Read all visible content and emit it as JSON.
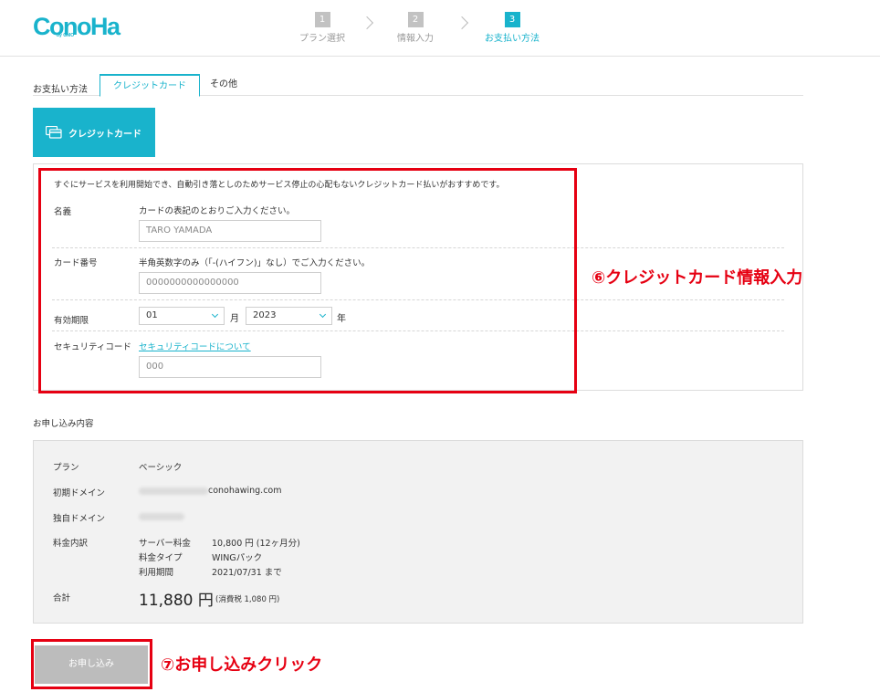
{
  "header": {
    "logo": "ConoHa",
    "logo_sub": "by GMO",
    "steps": [
      {
        "num": "1",
        "label": "プラン選択"
      },
      {
        "num": "2",
        "label": "情報入力"
      },
      {
        "num": "3",
        "label": "お支払い方法"
      }
    ]
  },
  "payment_tabs": {
    "label": "お支払い方法",
    "tabs": [
      "クレジットカード",
      "その他"
    ]
  },
  "card_button_label": "クレジットカード",
  "form": {
    "intro": "すぐにサービスを利用開始でき、自動引き落としのためサービス停止の心配もないクレジットカード払いがおすすめです。",
    "name": {
      "label": "名義",
      "note": "カードの表記のとおりご入力ください。",
      "placeholder": "TARO YAMADA"
    },
    "number": {
      "label": "カード番号",
      "note": "半角英数字のみ（「-(ハイフン)」なし）でご入力ください。",
      "placeholder": "0000000000000000"
    },
    "expiry": {
      "label": "有効期限",
      "month": "01",
      "month_unit": "月",
      "year": "2023",
      "year_unit": "年"
    },
    "security": {
      "label": "セキュリティコード",
      "link": "セキュリティコードについて",
      "placeholder": "000"
    }
  },
  "annotations": {
    "credit": "⑥クレジットカード情報入力",
    "submit": "⑦お申し込みクリック"
  },
  "summary": {
    "title": "お申し込み内容",
    "plan": {
      "label": "プラン",
      "value": "ベーシック"
    },
    "initial_domain": {
      "label": "初期ドメイン",
      "suffix": "conohawing.com"
    },
    "own_domain": {
      "label": "独自ドメイン"
    },
    "fee": {
      "label": "料金内訳",
      "items": [
        {
          "name": "サーバー料金",
          "value": "10,800 円 (12ヶ月分)"
        },
        {
          "name": "料金タイプ",
          "value": "WINGパック"
        },
        {
          "name": "利用期間",
          "value": "2021/07/31 まで"
        }
      ]
    },
    "total": {
      "label": "合計",
      "amount": "11,880 円",
      "tax": "(消費税 1,080 円)"
    }
  },
  "submit_label": "お申し込み",
  "colors": {
    "accent": "#19b3cc",
    "annotation": "#e60012",
    "button_disabled": "#bcbcbc"
  }
}
